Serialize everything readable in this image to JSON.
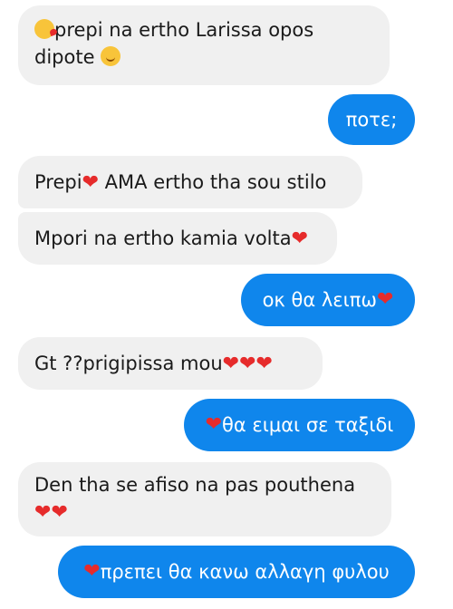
{
  "messages": [
    {
      "direction": "incoming",
      "text_a": "prepi na ertho Larissa opos",
      "text_b": "dipote",
      "icons": [
        "kissing-wink-emoji",
        "smile-emoji"
      ]
    },
    {
      "direction": "outgoing",
      "text": "ποτε;"
    },
    {
      "direction": "incoming",
      "text_a": "Prepi",
      "text_b": " AMA ertho tha sou stilo",
      "icons": [
        "heart"
      ]
    },
    {
      "direction": "incoming",
      "text": "Mpori na ertho kamia volta",
      "icons": [
        "heart"
      ]
    },
    {
      "direction": "outgoing",
      "text": "οκ θα λειπω",
      "icons": [
        "heart"
      ]
    },
    {
      "direction": "incoming",
      "text": "Gt ??prigipissa mou",
      "icons": [
        "heart",
        "heart",
        "heart"
      ]
    },
    {
      "direction": "outgoing",
      "text": " θα ειμαι σε ταξιδι",
      "icons": [
        "heart"
      ]
    },
    {
      "direction": "incoming",
      "text": "Den tha se afiso na pas pouthena",
      "icons": [
        "heart",
        "heart"
      ]
    },
    {
      "direction": "outgoing",
      "text": " πρεπει θα κανω αλλαγη φυλου",
      "icons": [
        "heart"
      ]
    }
  ],
  "colors": {
    "incoming_bubble": "#f0f0f0",
    "outgoing_bubble": "#0f86ec",
    "heart": "#e62b2b"
  }
}
